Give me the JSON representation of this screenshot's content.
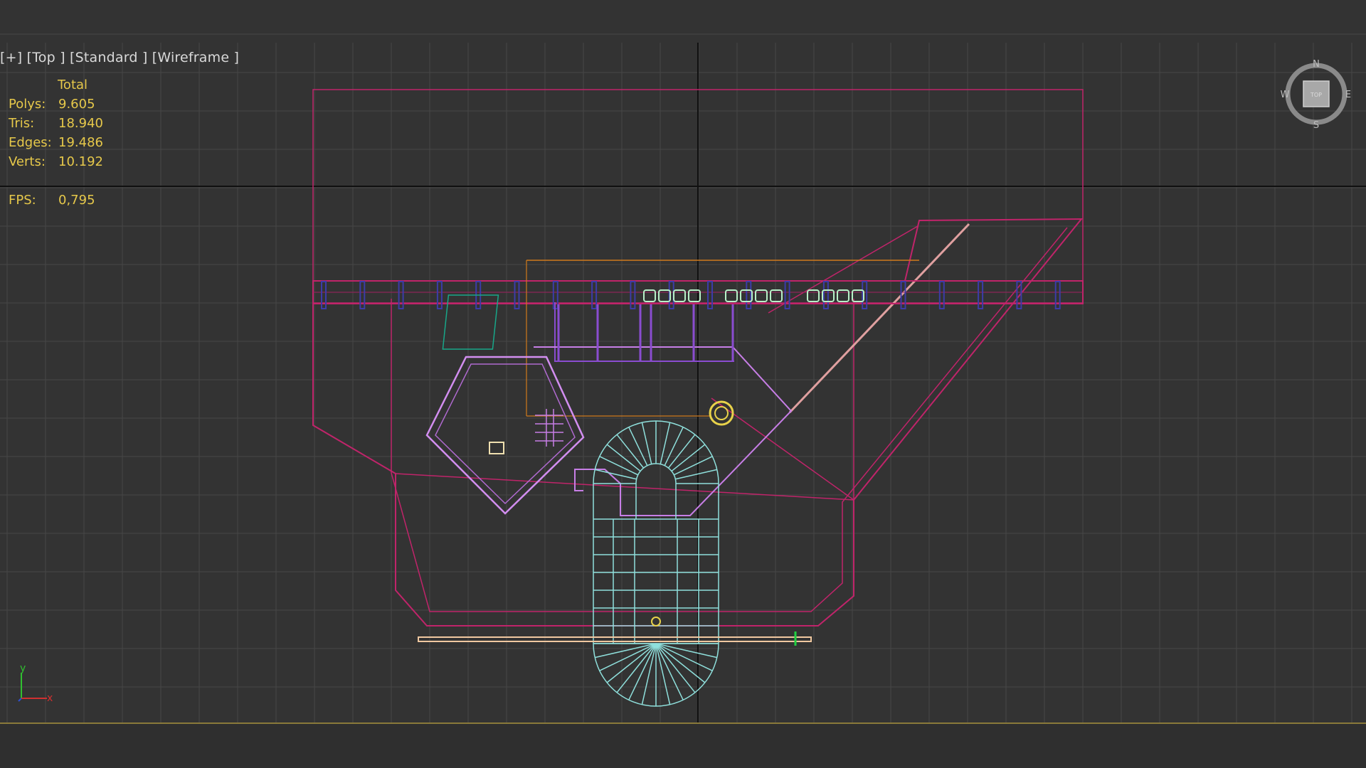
{
  "viewport": {
    "label_parts": [
      "[+]",
      "[Top ]",
      "[Standard ]",
      "[Wireframe ]"
    ]
  },
  "stats": {
    "header": "Total",
    "rows": [
      {
        "label": "Polys:",
        "value": "9.605"
      },
      {
        "label": "Tris:",
        "value": "18.940"
      },
      {
        "label": "Edges:",
        "value": "19.486"
      },
      {
        "label": "Verts:",
        "value": "10.192"
      }
    ],
    "fps_label": "FPS:",
    "fps_value": "0,795"
  },
  "viewcube": {
    "face_label": "TOP",
    "north": "N",
    "south": "S",
    "east": "E",
    "west": "W"
  },
  "axis_tripod": {
    "y": "y",
    "x": "x"
  },
  "colors": {
    "background": "#333333",
    "grid": "#4a4a4a",
    "grid_axis": "#101010",
    "stats_text": "#e6c84a",
    "label_text": "#d9d9d9",
    "wire_crimson": "#c0246a",
    "wire_violet": "#c77ee6",
    "wire_cyan": "#8fe0dc",
    "wire_orange": "#d07a1c",
    "wire_yellow": "#e8d24a",
    "wire_blue": "#3c3ca8",
    "wire_green": "#18a88a",
    "wire_purple": "#8a4cd0"
  }
}
